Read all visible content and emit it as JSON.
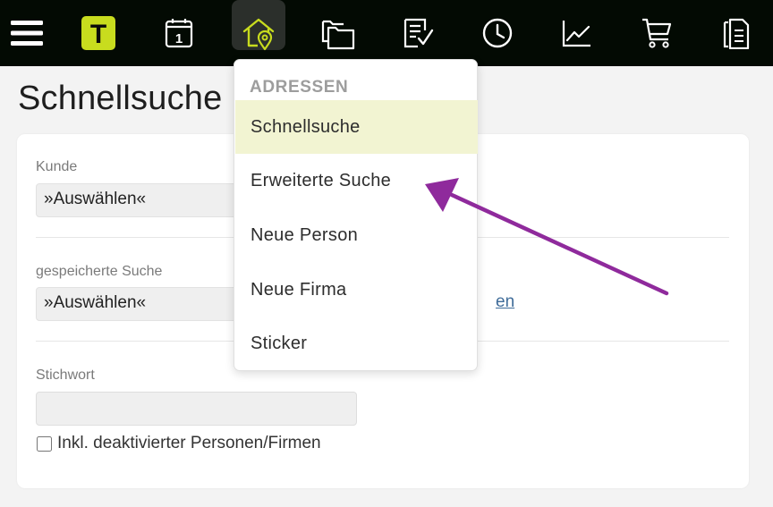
{
  "topbar": {
    "logo_letter": "T",
    "accent_color": "#c8dc1e",
    "icons": [
      "menu-icon",
      "logo-icon",
      "calendar-icon",
      "address-home-icon",
      "folders-icon",
      "task-list-icon",
      "clock-icon",
      "chart-icon",
      "cart-icon",
      "documents-icon"
    ],
    "calendar_day": "1"
  },
  "page": {
    "title": "Schnellsuche"
  },
  "form": {
    "kunde_label": "Kunde",
    "kunde_value": "»Auswählen«",
    "saved_search_label": "gespeicherte Suche",
    "saved_search_value": "»Auswählen«",
    "saved_search_link": "en",
    "keyword_label": "Stichwort",
    "keyword_value": "",
    "keyword_placeholder": "",
    "include_inactive_label": "Inkl. deaktivierter Personen/Firmen",
    "include_inactive_checked": false
  },
  "menu": {
    "header": "ADRESSEN",
    "items": [
      {
        "label": "Schnellsuche",
        "selected": true
      },
      {
        "label": "Erweiterte Suche",
        "selected": false
      },
      {
        "label": "Neue Person",
        "selected": false
      },
      {
        "label": "Neue Firma",
        "selected": false
      },
      {
        "label": "Sticker",
        "selected": false
      }
    ]
  },
  "annotation": {
    "arrow_color": "#8f2a9c"
  }
}
